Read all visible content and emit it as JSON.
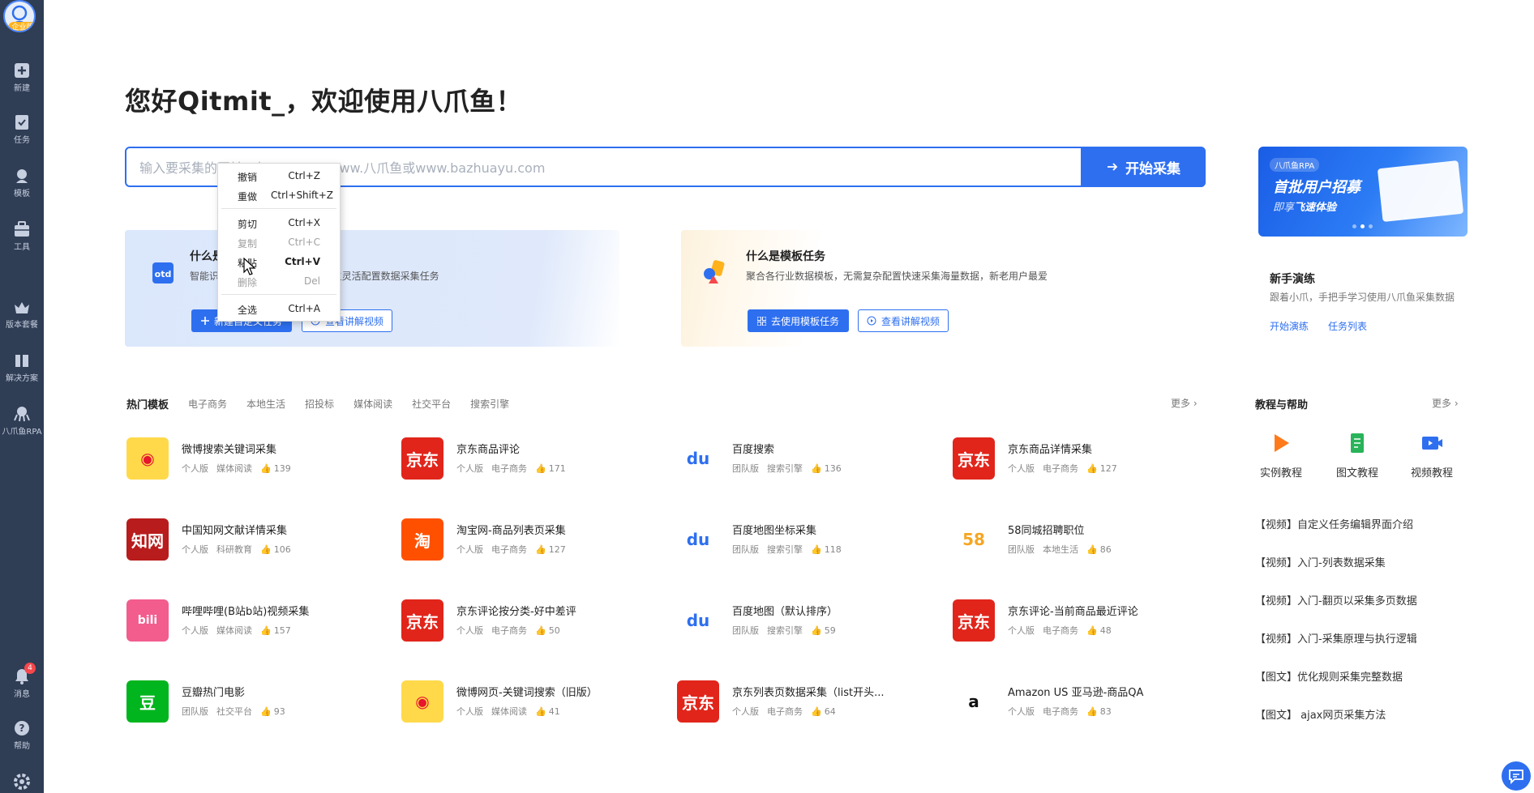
{
  "sidebar": {
    "avatar_badge": "企业版",
    "items": [
      {
        "label": "新建",
        "icon": "plus-square-icon"
      },
      {
        "label": "任务",
        "icon": "task-icon"
      },
      {
        "label": "模板",
        "icon": "template-icon"
      },
      {
        "label": "工具",
        "icon": "toolbox-icon"
      },
      {
        "label": "版本套餐",
        "icon": "crown-icon"
      },
      {
        "label": "解决方案",
        "icon": "solution-icon"
      },
      {
        "label": "八爪鱼RPA",
        "icon": "octopus-icon"
      },
      {
        "label": "消息",
        "icon": "bell-icon",
        "badge": "4"
      },
      {
        "label": "帮助",
        "icon": "help-icon"
      },
      {
        "label": "",
        "icon": "settings-icon"
      }
    ]
  },
  "greeting": "您好Qitmit_，欢迎使用八爪鱼！",
  "search": {
    "placeholder": "输入要采集的网址，如：https://www.八爪鱼或www.bazhuayu.com",
    "button_label": "开始采集"
  },
  "cards": {
    "custom": {
      "title": "什么是自定义任务",
      "desc": "智能识别网页数据，让您0代码自主灵活配置数据采集任务",
      "primary_button": "新建自定义任务",
      "video_button": "查看讲解视频"
    },
    "template": {
      "title": "什么是模板任务",
      "desc": "聚合各行业数据模板，无需复杂配置快速采集海量数据，新老用户最爱",
      "primary_button": "去使用模板任务",
      "video_button": "查看讲解视频"
    }
  },
  "banner": {
    "tag": "八爪鱼RPA",
    "title": "首批用户招募",
    "sub_prefix": "即享",
    "sub_emph": "飞速体验"
  },
  "newbie": {
    "title": "新手演练",
    "desc": "跟着小爪，手把手学习使用八爪鱼采集数据",
    "link_start": "开始演练",
    "link_tasks": "任务列表"
  },
  "hot": {
    "tabs": [
      "热门模板",
      "电子商务",
      "本地生活",
      "招投标",
      "媒体阅读",
      "社交平台",
      "搜索引擎"
    ],
    "more": "更多",
    "templates": [
      {
        "name": "微博搜索关键词采集",
        "edition": "个人版",
        "category": "媒体阅读",
        "likes": "139",
        "logo": "weibo"
      },
      {
        "name": "京东商品评论",
        "edition": "个人版",
        "category": "电子商务",
        "likes": "171",
        "logo": "jd"
      },
      {
        "name": "百度搜索",
        "edition": "团队版",
        "category": "搜索引擎",
        "likes": "136",
        "logo": "baidu"
      },
      {
        "name": "京东商品详情采集",
        "edition": "个人版",
        "category": "电子商务",
        "likes": "127",
        "logo": "jd"
      },
      {
        "name": "中国知网文献详情采集",
        "edition": "个人版",
        "category": "科研教育",
        "likes": "106",
        "logo": "cnki"
      },
      {
        "name": "淘宝网-商品列表页采集",
        "edition": "个人版",
        "category": "电子商务",
        "likes": "127",
        "logo": "taobao"
      },
      {
        "name": "百度地图坐标采集",
        "edition": "团队版",
        "category": "搜索引擎",
        "likes": "118",
        "logo": "baidu"
      },
      {
        "name": "58同城招聘职位",
        "edition": "团队版",
        "category": "本地生活",
        "likes": "86",
        "logo": "58"
      },
      {
        "name": "哔哩哔哩(B站b站)视频采集",
        "edition": "个人版",
        "category": "媒体阅读",
        "likes": "157",
        "logo": "bilibili"
      },
      {
        "name": "京东评论按分类-好中差评",
        "edition": "个人版",
        "category": "电子商务",
        "likes": "50",
        "logo": "jd"
      },
      {
        "name": "百度地图（默认排序）",
        "edition": "团队版",
        "category": "搜索引擎",
        "likes": "59",
        "logo": "baidu"
      },
      {
        "name": "京东评论-当前商品最近评论",
        "edition": "个人版",
        "category": "电子商务",
        "likes": "48",
        "logo": "jd"
      },
      {
        "name": "豆瓣热门电影",
        "edition": "团队版",
        "category": "社交平台",
        "likes": "93",
        "logo": "douban"
      },
      {
        "name": "微博网页-关键词搜索（旧版）",
        "edition": "个人版",
        "category": "媒体阅读",
        "likes": "41",
        "logo": "weibo"
      },
      {
        "name": "京东列表页数据采集（list开头...",
        "edition": "个人版",
        "category": "电子商务",
        "likes": "64",
        "logo": "jd"
      },
      {
        "name": "Amazon US 亚马逊-商品QA",
        "edition": "个人版",
        "category": "电子商务",
        "likes": "83",
        "logo": "amazon"
      }
    ]
  },
  "help": {
    "title": "教程与帮助",
    "more": "更多",
    "kinds": [
      {
        "label": "实例教程",
        "icon": "play-icon"
      },
      {
        "label": "图文教程",
        "icon": "document-icon"
      },
      {
        "label": "视频教程",
        "icon": "video-icon"
      }
    ],
    "links": [
      "【视频】自定义任务编辑界面介绍",
      "【视频】入门-列表数据采集",
      "【视频】入门-翻页以采集多页数据",
      "【视频】入门-采集原理与执行逻辑",
      "【图文】优化规则采集完整数据",
      "【图文】 ajax网页采集方法"
    ]
  },
  "context_menu": {
    "items": [
      {
        "label": "撤销",
        "shortcut": "Ctrl+Z",
        "enabled": true
      },
      {
        "label": "重做",
        "shortcut": "Ctrl+Shift+Z",
        "enabled": true
      },
      {
        "label": "剪切",
        "shortcut": "Ctrl+X",
        "enabled": true
      },
      {
        "label": "复制",
        "shortcut": "Ctrl+C",
        "enabled": false
      },
      {
        "label": "粘贴",
        "shortcut": "Ctrl+V",
        "enabled": true
      },
      {
        "label": "删除",
        "shortcut": "Del",
        "enabled": false
      },
      {
        "label": "全选",
        "shortcut": "Ctrl+A",
        "enabled": true
      }
    ]
  },
  "colors": {
    "primary": "#2e6ff0",
    "sidebar": "#2f3d55"
  }
}
